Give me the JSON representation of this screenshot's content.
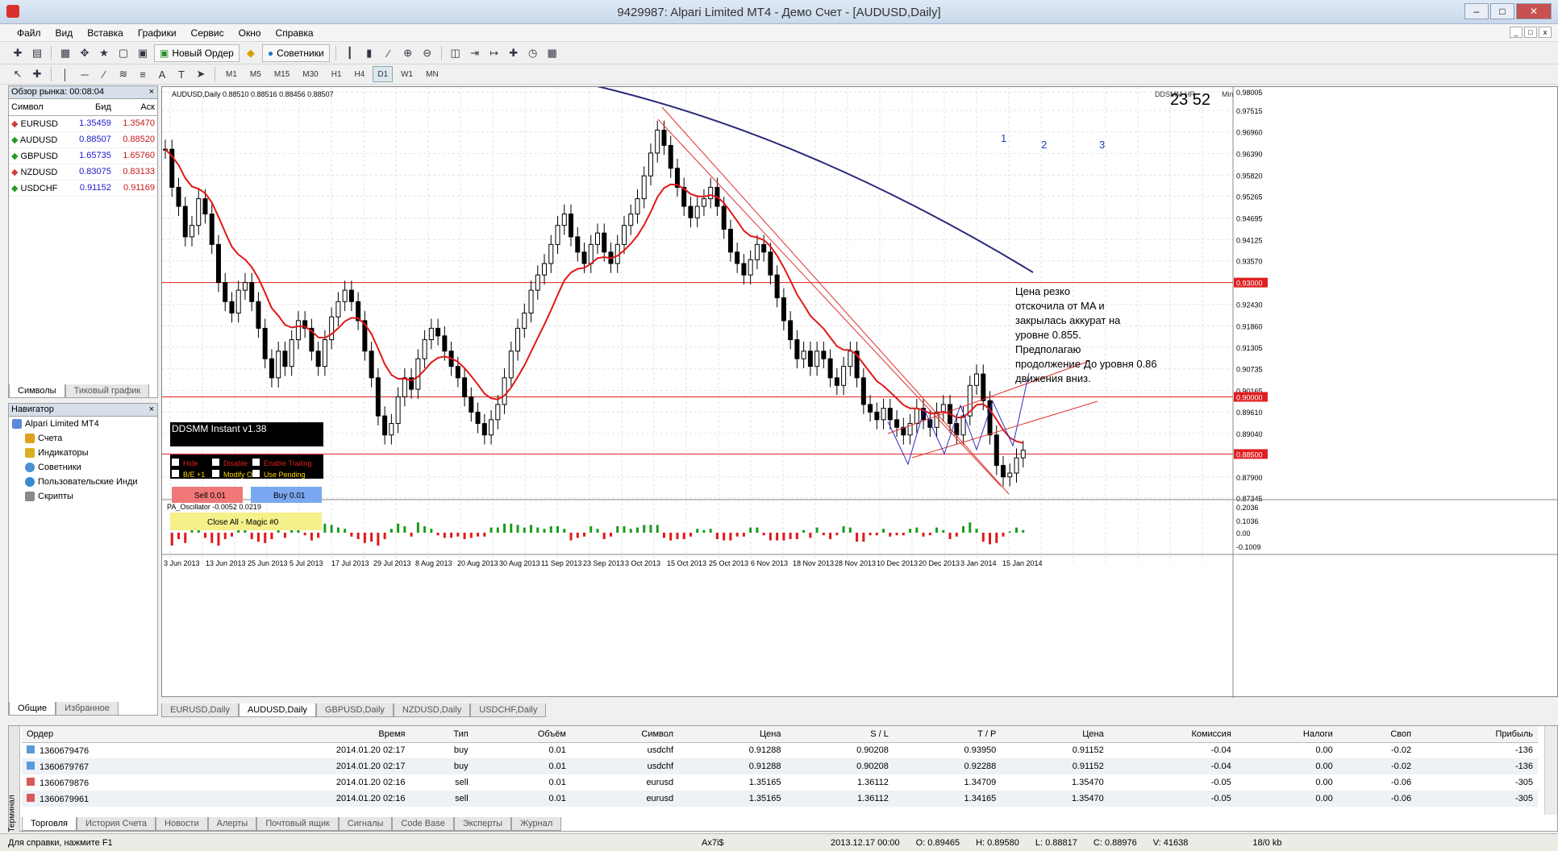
{
  "window": {
    "title": "9429987: Alpari Limited MT4 - Демо Счет - [AUDUSD,Daily]"
  },
  "menu": [
    "Файл",
    "Вид",
    "Вставка",
    "Графики",
    "Сервис",
    "Окно",
    "Справка"
  ],
  "toolbar": {
    "new_order": "Новый Ордер",
    "experts": "Советники",
    "timeframes": [
      "M1",
      "M5",
      "M15",
      "M30",
      "H1",
      "H4",
      "D1",
      "W1",
      "MN"
    ],
    "active_tf": "D1"
  },
  "market_watch": {
    "title": "Обзор рынка: 00:08:04",
    "cols": [
      "Символ",
      "Бид",
      "Аск"
    ],
    "rows": [
      {
        "s": "EURUSD",
        "b": "1.35459",
        "a": "1.35470",
        "dir": "down"
      },
      {
        "s": "AUDUSD",
        "b": "0.88507",
        "a": "0.88520",
        "dir": "up"
      },
      {
        "s": "GBPUSD",
        "b": "1.65735",
        "a": "1.65760",
        "dir": "up"
      },
      {
        "s": "NZDUSD",
        "b": "0.83075",
        "a": "0.83133",
        "dir": "down"
      },
      {
        "s": "USDCHF",
        "b": "0.91152",
        "a": "0.91169",
        "dir": "up"
      }
    ],
    "tabs": [
      "Символы",
      "Тиковый график"
    ]
  },
  "navigator": {
    "title": "Навигатор",
    "root": "Alpari Limited MT4",
    "items": [
      "Счета",
      "Индикаторы",
      "Советники",
      "Пользовательские Инди",
      "Скрипты"
    ],
    "tabs": [
      "Общие",
      "Избранное"
    ]
  },
  "chart": {
    "header": "AUDUSD,Daily  0.88510 0.88516 0.88456 0.88507",
    "timer": "23 52",
    "timer_label": "DDSMM-HR",
    "min": "Min",
    "price_labels": [
      "0.98005",
      "0.97515",
      "0.96960",
      "0.96390",
      "0.95820",
      "0.95265",
      "0.94695",
      "0.94125",
      "0.93570",
      "0.93000",
      "0.92430",
      "0.91860",
      "0.91305",
      "0.90735",
      "0.90165",
      "0.90000",
      "0.89610",
      "0.89040",
      "0.88500",
      "0.87900",
      "0.87345"
    ],
    "highlight_prices": [
      "0.93000",
      "0.90000",
      "0.88500"
    ],
    "date_labels": [
      "3 Jun 2013",
      "13 Jun 2013",
      "25 Jun 2013",
      "5 Jul 2013",
      "17 Jul 2013",
      "29 Jul 2013",
      "8 Aug 2013",
      "20 Aug 2013",
      "30 Aug 2013",
      "11 Sep 2013",
      "23 Sep 2013",
      "3 Oct 2013",
      "15 Oct 2013",
      "25 Oct 2013",
      "6 Nov 2013",
      "18 Nov 2013",
      "28 Nov 2013",
      "10 Dec 2013",
      "20 Dec 2013",
      "3 Jan 2014",
      "15 Jan 2014"
    ],
    "wave_labels": [
      "1",
      "2",
      "3"
    ],
    "annotation": [
      "Цена резко",
      "отскочила от MA и",
      "закрылась аккурат на",
      "уровне 0.855.",
      "Предполагаю",
      "продолжение",
      "движения вниз.",
      "До уровня 0.86"
    ],
    "osc_label": "PA_Oscillator -0.0052 0.0219",
    "osc_levels": [
      "0.2036",
      "0.1036",
      "0.00",
      "-0.1009"
    ],
    "panel": {
      "title": "DDSMM Instant v1.38",
      "hide": "Hide",
      "disable": "Disable",
      "trailing": "Enable Trailing",
      "be": "B/E +1",
      "modify": "Modify Ord",
      "pending": "Use Pending",
      "sell": "Sell 0.01",
      "buy": "Buy 0.01",
      "closeall": "Close All - Magic #0"
    },
    "tabs": [
      "EURUSD,Daily",
      "AUDUSD,Daily",
      "GBPUSD,Daily",
      "NZDUSD,Daily",
      "USDCHF,Daily"
    ],
    "active_tab": "AUDUSD,Daily"
  },
  "terminal": {
    "cols": [
      "Ордер",
      "Время",
      "Тип",
      "Объём",
      "Символ",
      "Цена",
      "S / L",
      "T / P",
      "Цена",
      "Комиссия",
      "Налоги",
      "Своп",
      "Прибыль"
    ],
    "rows": [
      [
        "1360679476",
        "2014.01.20 02:17",
        "buy",
        "0.01",
        "usdchf",
        "0.91288",
        "0.90208",
        "0.93950",
        "0.91152",
        "-0.04",
        "0.00",
        "-0.02",
        "-136"
      ],
      [
        "1360679767",
        "2014.01.20 02:17",
        "buy",
        "0.01",
        "usdchf",
        "0.91288",
        "0.90208",
        "0.92288",
        "0.91152",
        "-0.04",
        "0.00",
        "-0.02",
        "-136"
      ],
      [
        "1360679876",
        "2014.01.20 02:16",
        "sell",
        "0.01",
        "eurusd",
        "1.35165",
        "1.36112",
        "1.34709",
        "1.35470",
        "-0.05",
        "0.00",
        "-0.06",
        "-305"
      ],
      [
        "1360679961",
        "2014.01.20 02:16",
        "sell",
        "0.01",
        "eurusd",
        "1.35165",
        "1.36112",
        "1.34165",
        "1.35470",
        "-0.05",
        "0.00",
        "-0.06",
        "-305"
      ]
    ],
    "tabs": [
      "Торговля",
      "История Счета",
      "Новости",
      "Алерты",
      "Почтовый ящик",
      "Сигналы",
      "Code Base",
      "Эксперты",
      "Журнал"
    ],
    "side": "Терминал"
  },
  "status": {
    "help": "Для справки, нажмите F1",
    "profile": "Ax7i$",
    "bar": "2013.12.17 00:00",
    "o": "O: 0.89465",
    "h": "H: 0.89580",
    "l": "L: 0.88817",
    "c": "C: 0.88976",
    "v": "V: 41638",
    "traffic": "18/0 kb"
  }
}
